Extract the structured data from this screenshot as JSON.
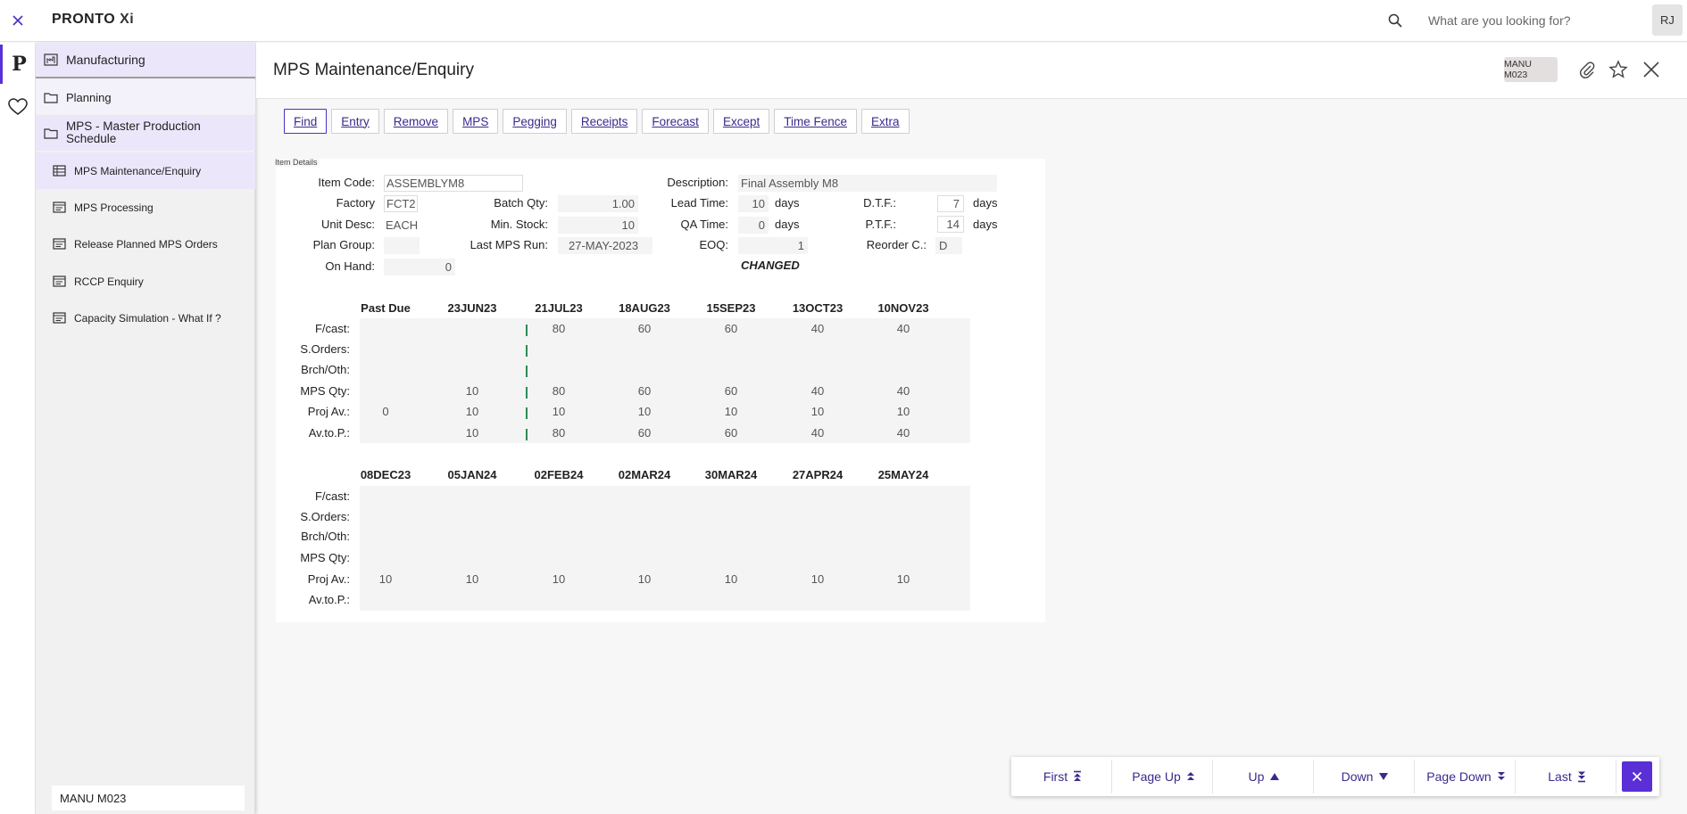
{
  "app": {
    "brand": "PRONTO",
    "brand_suffix": "Xi",
    "search_placeholder": "What are you looking for?",
    "user_initials": "RJ"
  },
  "sidebar": {
    "category": "Manufacturing",
    "folder": "Planning",
    "subfolder": "MPS - Master Production Schedule",
    "items": [
      {
        "label": "MPS Maintenance/Enquiry",
        "icon": "table-icon",
        "active": true
      },
      {
        "label": "MPS Processing",
        "icon": "screen-icon"
      },
      {
        "label": "Release Planned MPS Orders",
        "icon": "screen-icon"
      },
      {
        "label": "RCCP Enquiry",
        "icon": "screen-icon"
      },
      {
        "label": "Capacity Simulation - What If ?",
        "icon": "screen-icon"
      }
    ],
    "footer": "MANU M023"
  },
  "header": {
    "title": "MPS Maintenance/Enquiry",
    "badge": "MANU M023"
  },
  "actions": [
    {
      "label": "Find",
      "name": "find-button"
    },
    {
      "label": "Entry",
      "name": "entry-button"
    },
    {
      "label": "Remove",
      "name": "remove-button"
    },
    {
      "label": "MPS",
      "name": "mps-button"
    },
    {
      "label": "Pegging",
      "name": "pegging-button"
    },
    {
      "label": "Receipts",
      "name": "receipts-button"
    },
    {
      "label": "Forecast",
      "name": "forecast-button"
    },
    {
      "label": "Except",
      "name": "except-button"
    },
    {
      "label": "Time Fence",
      "name": "time-fence-button"
    },
    {
      "label": "Extra",
      "name": "extra-button"
    }
  ],
  "item_details": {
    "legend": "Item Details",
    "item_code_label": "Item Code:",
    "item_code": "ASSEMBLYM8",
    "description_label": "Description:",
    "description": "Final Assembly M8",
    "factory_label": "Factory",
    "factory": "FCT2",
    "batch_qty_label": "Batch Qty:",
    "batch_qty": "1.00",
    "lead_time_label": "Lead Time:",
    "lead_time": "10",
    "lead_time_unit": "days",
    "dtf_label": "D.T.F.:",
    "dtf": "7",
    "dtf_unit": "days",
    "unit_desc_label": "Unit Desc:",
    "unit_desc": "EACH",
    "min_stock_label": "Min. Stock:",
    "min_stock": "10",
    "qa_time_label": "QA Time:",
    "qa_time": "0",
    "qa_time_unit": "days",
    "ptf_label": "P.T.F.:",
    "ptf": "14",
    "ptf_unit": "days",
    "plan_group_label": "Plan Group:",
    "plan_group": "",
    "last_mps_run_label": "Last MPS Run:",
    "last_mps_run": "27-MAY-2023",
    "eoq_label": "EOQ:",
    "eoq": "1",
    "reorder_label": "Reorder C.:",
    "reorder": "D",
    "on_hand_label": "On Hand:",
    "on_hand": "0",
    "status": "CHANGED"
  },
  "grid1": {
    "columns": [
      "Past Due",
      "23JUN23",
      "21JUL23",
      "18AUG23",
      "15SEP23",
      "13OCT23",
      "10NOV23"
    ],
    "rows": [
      {
        "label": "F/cast:",
        "cells": [
          "",
          "",
          "80",
          "60",
          "60",
          "40",
          "40"
        ]
      },
      {
        "label": "S.Orders:",
        "cells": [
          "",
          "",
          "",
          "",
          "",
          "",
          ""
        ]
      },
      {
        "label": "Brch/Oth:",
        "cells": [
          "",
          "",
          "",
          "",
          "",
          "",
          ""
        ]
      },
      {
        "label": "MPS Qty:",
        "cells": [
          "",
          "10",
          "80",
          "60",
          "60",
          "40",
          "40"
        ]
      },
      {
        "label": "Proj Av.:",
        "cells": [
          "0",
          "10",
          "10",
          "10",
          "10",
          "10",
          "10"
        ]
      },
      {
        "label": "Av.to.P.:",
        "cells": [
          "",
          "10",
          "80",
          "60",
          "60",
          "40",
          "40"
        ]
      }
    ]
  },
  "grid2": {
    "columns": [
      "08DEC23",
      "05JAN24",
      "02FEB24",
      "02MAR24",
      "30MAR24",
      "27APR24",
      "25MAY24"
    ],
    "rows": [
      {
        "label": "F/cast:",
        "cells": [
          "",
          "",
          "",
          "",
          "",
          "",
          ""
        ]
      },
      {
        "label": "S.Orders:",
        "cells": [
          "",
          "",
          "",
          "",
          "",
          "",
          ""
        ]
      },
      {
        "label": "Brch/Oth:",
        "cells": [
          "",
          "",
          "",
          "",
          "",
          "",
          ""
        ]
      },
      {
        "label": "MPS Qty:",
        "cells": [
          "",
          "",
          "",
          "",
          "",
          "",
          ""
        ]
      },
      {
        "label": "Proj Av.:",
        "cells": [
          "10",
          "10",
          "10",
          "10",
          "10",
          "10",
          "10"
        ]
      },
      {
        "label": "Av.to.P.:",
        "cells": [
          "",
          "",
          "",
          "",
          "",
          "",
          ""
        ]
      }
    ]
  },
  "pager": [
    {
      "label": "First",
      "icon": "double-up-bar-icon",
      "name": "first-button"
    },
    {
      "label": "Page Up",
      "icon": "double-up-icon",
      "name": "page-up-button"
    },
    {
      "label": "Up",
      "icon": "up-triangle-icon",
      "name": "up-button"
    },
    {
      "label": "Down",
      "icon": "down-triangle-icon",
      "name": "down-button"
    },
    {
      "label": "Page Down",
      "icon": "double-down-icon",
      "name": "page-down-button"
    },
    {
      "label": "Last",
      "icon": "double-down-bar-icon",
      "name": "last-button"
    }
  ],
  "colors": {
    "accent": "#5a2fd6",
    "selected_bg": "#ece6fb",
    "link": "#3a2a8c",
    "fence_marker": "#2e8b57"
  }
}
